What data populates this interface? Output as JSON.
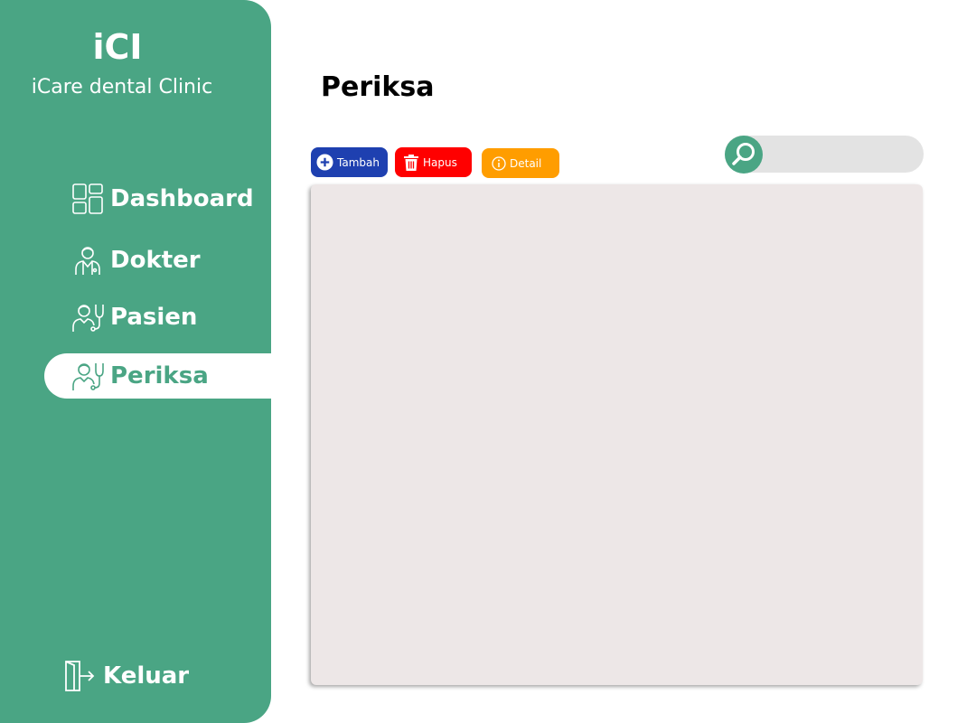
{
  "sidebar": {
    "logo": "iCI",
    "clinic_name": "iCare dental Clinic",
    "items": [
      {
        "label": "Dashboard",
        "icon": "dashboard-icon",
        "active": false
      },
      {
        "label": "Dokter",
        "icon": "doctor-icon",
        "active": false
      },
      {
        "label": "Pasien",
        "icon": "patient-icon",
        "active": false
      },
      {
        "label": "Periksa",
        "icon": "examination-icon",
        "active": true
      }
    ],
    "logout_label": "Keluar",
    "logout_icon": "logout-icon"
  },
  "main": {
    "title": "Periksa",
    "toolbar": {
      "add_label": "Tambah",
      "delete_label": "Hapus",
      "detail_label": "Detail"
    },
    "search": {
      "icon": "search-icon",
      "placeholder": ""
    }
  },
  "colors": {
    "primary": "#4aa584",
    "add_button": "#1e40b0",
    "delete_button": "#ff0000",
    "detail_button": "#ff9d00",
    "search_bg": "#e3e3e3",
    "table_bg": "#ede7e7"
  }
}
